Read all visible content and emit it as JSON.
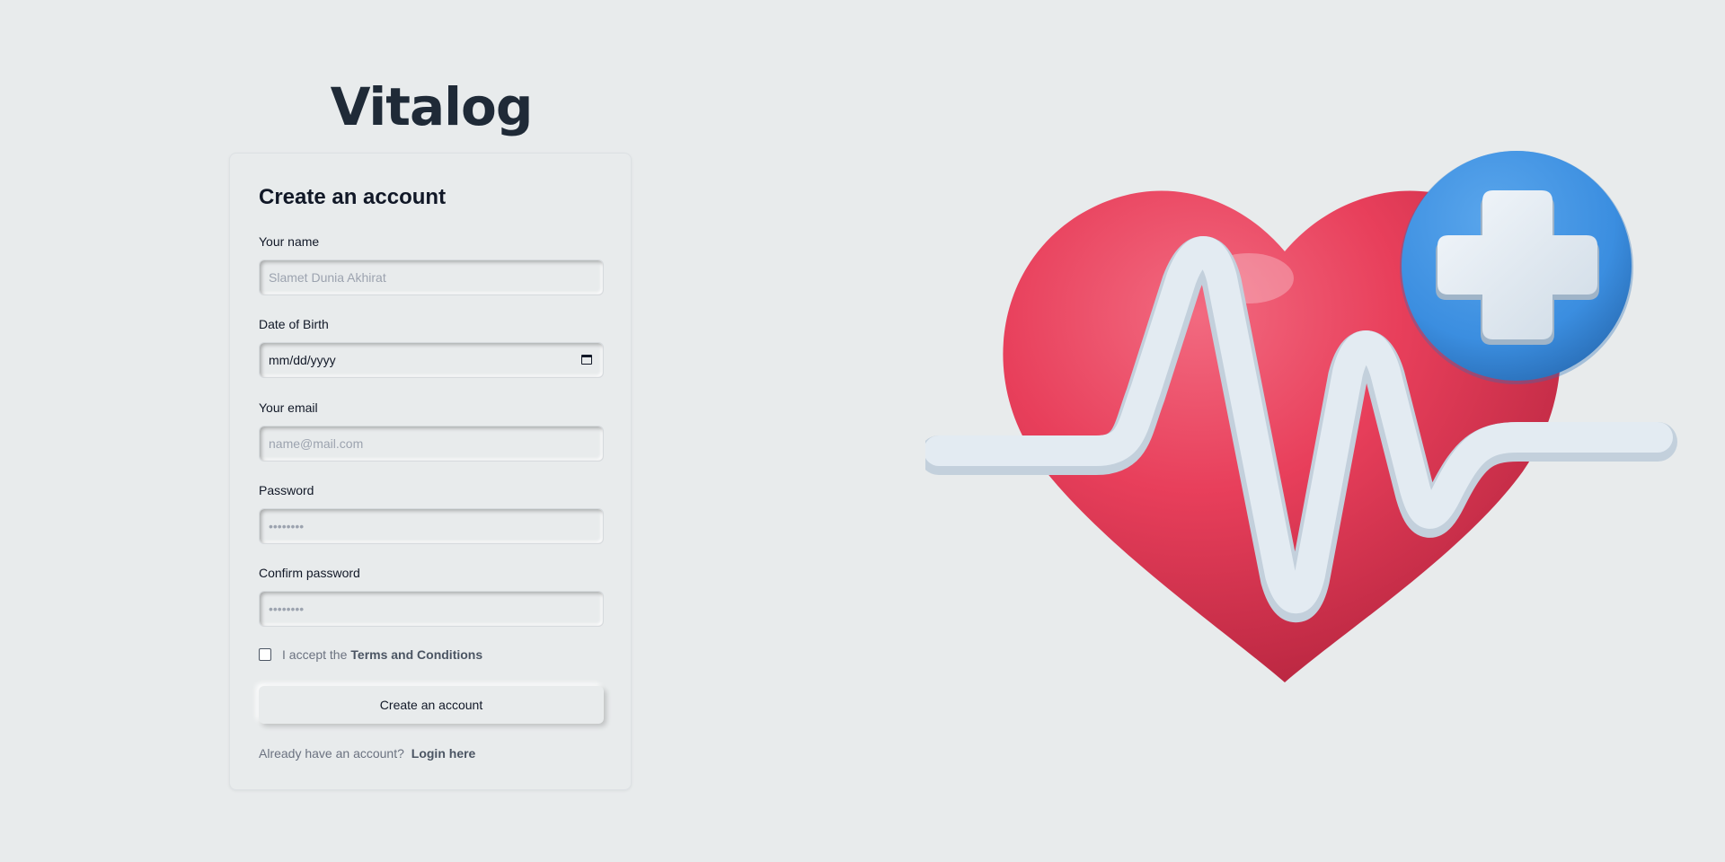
{
  "brand": {
    "logo_text": "Vitalog"
  },
  "form": {
    "title": "Create an account",
    "fields": [
      {
        "label": "Your name",
        "placeholder": "Slamet Dunia Akhirat",
        "value": ""
      },
      {
        "label": "Date of Birth",
        "placeholder": "",
        "value": "mm/dd/yyyy"
      },
      {
        "label": "Your email",
        "placeholder": "name@mail.com",
        "value": ""
      },
      {
        "label": "Password",
        "placeholder": "••••••••",
        "value": ""
      },
      {
        "label": "Confirm password",
        "placeholder": "••••••••",
        "value": ""
      }
    ],
    "terms": {
      "checked": false,
      "prefix": "I accept the",
      "link": "Terms and Conditions"
    },
    "submit_label": "Create an account",
    "signin": {
      "prompt": "Already have an account?",
      "link": "Login here"
    }
  },
  "icons": {
    "date_picker": "calendar-icon",
    "illustration": "heart-pulse-plus-illustration"
  },
  "colors": {
    "background": "#e8ebec",
    "heart_red": "#e83f5b",
    "plus_badge_blue": "#3b8ee0",
    "pulse_line": "#dbe5ee",
    "text_dark": "#111827",
    "text_muted": "#6b7280"
  }
}
